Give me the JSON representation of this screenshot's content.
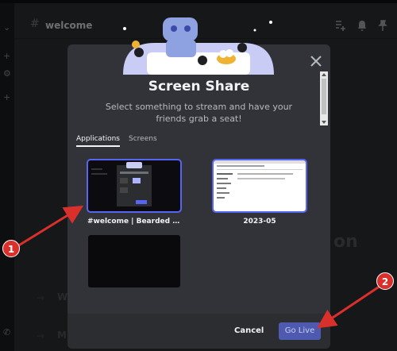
{
  "background": {
    "channel_name": "welcome",
    "large_text_fragment": "on",
    "row_glyph_1": "W",
    "row_glyph_2": "M"
  },
  "modal": {
    "title": "Screen Share",
    "subtitle": "Select something to stream and have your friends grab a seat!",
    "tabs": [
      {
        "label": "Applications",
        "active": true
      },
      {
        "label": "Screens",
        "active": false
      }
    ],
    "sources": [
      {
        "label": "#welcome | Bearded Dem...",
        "selected": true,
        "preview": "discord-window"
      },
      {
        "label": "2023-05",
        "selected": false,
        "preview": "spreadsheet-window"
      },
      {
        "label": "",
        "selected": false,
        "preview": "black-window"
      }
    ],
    "footer": {
      "cancel_label": "Cancel",
      "go_live_label": "Go Live"
    }
  },
  "annotations": [
    {
      "number": "1"
    },
    {
      "number": "2"
    }
  ],
  "colors": {
    "accent": "#5865f2",
    "go_live_button": "#4e5ab0",
    "annotation_red": "#d9302c",
    "modal_bg": "#313338",
    "footer_bg": "#2b2d31"
  }
}
